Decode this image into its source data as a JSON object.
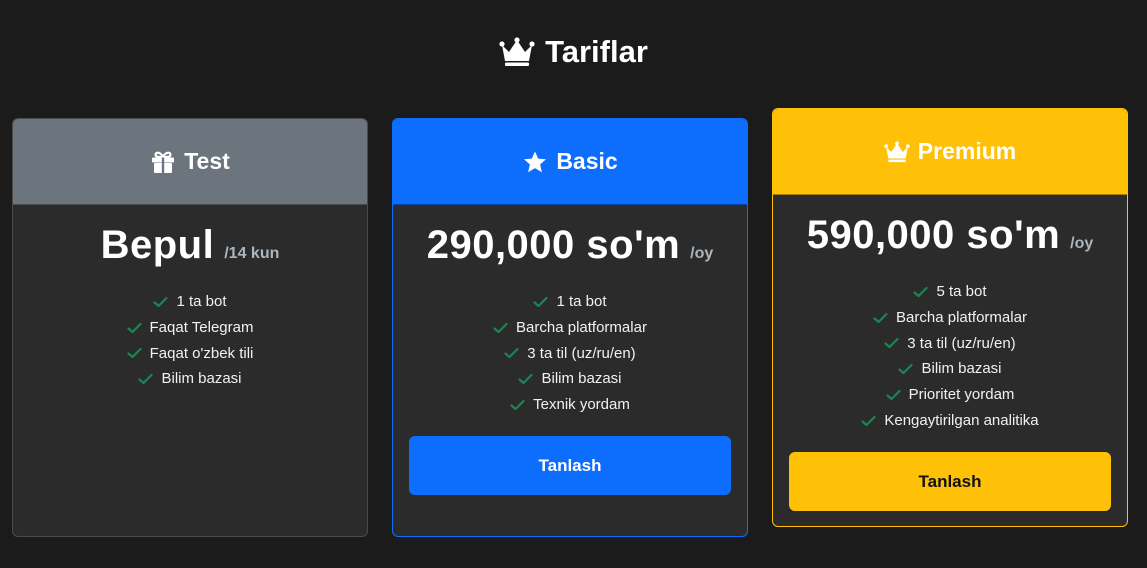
{
  "page": {
    "title": "Tariflar",
    "title_icon": "crown-icon"
  },
  "colors": {
    "background": "#1b1b1b",
    "card": "#2b2b2b",
    "test": "#6c757d",
    "basic": "#0d6efd",
    "premium": "#ffc107",
    "check": "#198754"
  },
  "plans": {
    "test": {
      "name": "Test",
      "icon": "gift-icon",
      "price": "Bepul",
      "period": "/14 kun",
      "features": [
        "1 ta bot",
        "Faqat Telegram",
        "Faqat o'zbek tili",
        "Bilim bazasi"
      ]
    },
    "basic": {
      "name": "Basic",
      "icon": "star-icon",
      "price": "290,000 so'm",
      "period": "/oy",
      "features": [
        "1 ta bot",
        "Barcha platformalar",
        "3 ta til (uz/ru/en)",
        "Bilim bazasi",
        "Texnik yordam"
      ],
      "button_label": "Tanlash"
    },
    "premium": {
      "name": "Premium",
      "icon": "crown-icon",
      "price": "590,000 so'm",
      "period": "/oy",
      "features": [
        "5 ta bot",
        "Barcha platformalar",
        "3 ta til (uz/ru/en)",
        "Bilim bazasi",
        "Prioritet yordam",
        "Kengaytirilgan analitika"
      ],
      "button_label": "Tanlash"
    }
  }
}
